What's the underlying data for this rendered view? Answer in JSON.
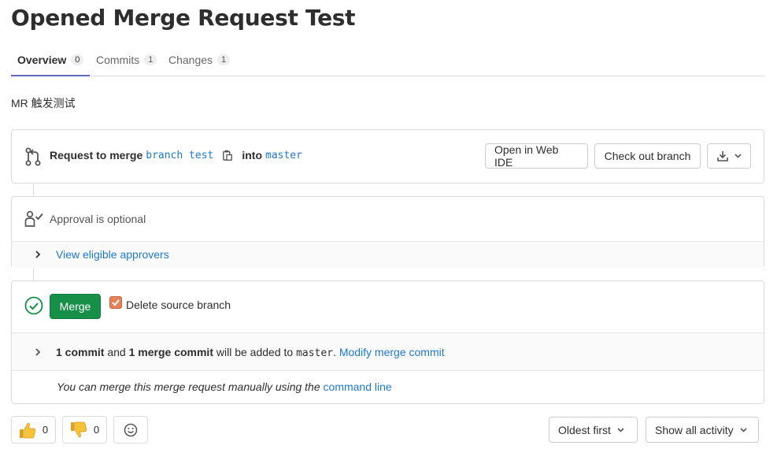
{
  "page": {
    "title": "Opened Merge Request Test"
  },
  "tabs": [
    {
      "label": "Overview",
      "count": "0"
    },
    {
      "label": "Commits",
      "count": "1"
    },
    {
      "label": "Changes",
      "count": "1"
    }
  ],
  "description": "MR 触发测试",
  "merge_info": {
    "request_label": "Request to merge",
    "source_branch": "branch test",
    "into_label": "into",
    "target_branch": "master",
    "open_web_ide": "Open in Web IDE",
    "check_out_branch": "Check out branch"
  },
  "approval": {
    "status": "Approval is optional",
    "view_approvers": "View eligible approvers"
  },
  "merge": {
    "button": "Merge",
    "delete_source_branch": "Delete source branch",
    "delete_source_checked": true,
    "commit_count": "1 commit",
    "and_text": "and",
    "merge_commit_count": "1 merge commit",
    "will_be_added": "will be added to",
    "target_branch": "master",
    "period": ".",
    "modify_link": "Modify merge commit",
    "manual_text": "You can merge this merge request manually using the",
    "command_line_link": "command line"
  },
  "awards": {
    "thumbs_up_count": "0",
    "thumbs_down_count": "0"
  },
  "sort": {
    "selected": "Oldest first"
  },
  "filter": {
    "selected": "Show all activity"
  },
  "colors": {
    "link": "#1f78d1",
    "merge_button": "#168f48",
    "checkbox": "#e6825a",
    "success_icon": "#168f48",
    "tab_active_border": "#6666c4"
  },
  "icons": {
    "merge_request": "git-merge-icon",
    "copy": "copy-to-clipboard-icon",
    "download": "download-icon",
    "approval": "approval-user-icon",
    "success": "check-circle-icon",
    "thumbs_up": "thumbs-up-emoji",
    "thumbs_down": "thumbs-down-emoji",
    "emoji_picker": "smiley-icon"
  }
}
